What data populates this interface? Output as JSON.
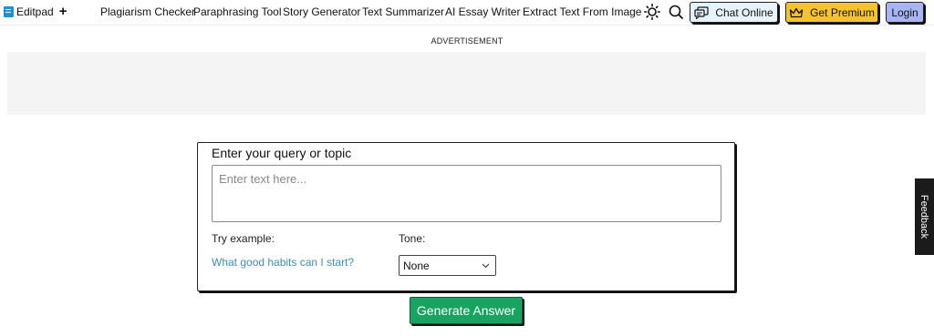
{
  "header": {
    "logo_text": "Editpad",
    "logo_plus": "+",
    "nav": [
      "Plagiarism Checker",
      "Paraphrasing Tool",
      "Story Generator",
      "Text Summarizer",
      "AI Essay Writer",
      "Extract Text From Image"
    ],
    "theme_icon": "sun-icon",
    "search_icon": "search-icon",
    "chat_label": "Chat Online",
    "chat_icon": "chat-bubbles-icon",
    "premium_label": "Get Premium",
    "premium_icon": "crown-icon",
    "login_label": "Login"
  },
  "ad": {
    "label": "ADVERTISEMENT"
  },
  "form": {
    "title": "Enter your query or topic",
    "placeholder": "Enter text here...",
    "try_label": "Try example:",
    "example_text": "What good habits can I start?",
    "tone_label": "Tone:",
    "tone_value": "None"
  },
  "generate_label": "Generate Answer",
  "feedback_label": "Feedback",
  "colors": {
    "chat_bg": "#e7f3fc",
    "premium_bg": "#f6c22d",
    "login_bg": "#a9b4f4",
    "generate_bg": "#1aa260",
    "link": "#3a8ebd"
  }
}
